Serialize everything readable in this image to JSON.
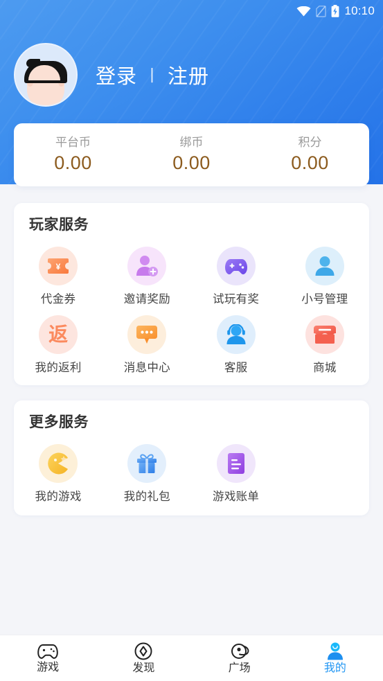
{
  "status_bar": {
    "time": "10:10",
    "icons": [
      "wifi-icon",
      "sim-off-icon",
      "battery-charging-icon"
    ]
  },
  "header": {
    "avatar_name": "default-user-avatar",
    "login_label": "登录",
    "separator": "丨",
    "register_label": "注册",
    "background_color": "#3E8FEE"
  },
  "balance": {
    "items": [
      {
        "label": "平台币",
        "value": "0.00"
      },
      {
        "label": "绑币",
        "value": "0.00"
      },
      {
        "label": "积分",
        "value": "0.00"
      }
    ],
    "value_color": "#8C5B1E",
    "label_color": "#9A9A9A"
  },
  "player_services": {
    "title": "玩家服务",
    "items": [
      {
        "label": "代金券",
        "icon": "voucher-icon",
        "bg": "#FDE7DE",
        "fg": "#FB8A4E"
      },
      {
        "label": "邀请奖励",
        "icon": "invite-user-icon",
        "bg": "#F7E4FB",
        "fg": "#D08BF0"
      },
      {
        "label": "试玩有奖",
        "icon": "gamepad-icon",
        "bg": "#EAE4FB",
        "fg": "#7A5CF0"
      },
      {
        "label": "小号管理",
        "icon": "person-icon",
        "bg": "#DDEFFB",
        "fg": "#4EB3EC"
      },
      {
        "label": "我的返利",
        "icon": "rebate-icon",
        "bg": "#FDE5DF",
        "fg": "#FB8A5E"
      },
      {
        "label": "消息中心",
        "icon": "message-icon",
        "bg": "#FDEEDC",
        "fg": "#FBA13E"
      },
      {
        "label": "客服",
        "icon": "headset-icon",
        "bg": "#DFEEFC",
        "fg": "#2196F3"
      },
      {
        "label": "商城",
        "icon": "shop-icon",
        "bg": "#FDE2DF",
        "fg": "#F4604F"
      }
    ]
  },
  "more_services": {
    "title": "更多服务",
    "items": [
      {
        "label": "我的游戏",
        "icon": "pacman-icon",
        "bg": "#FDF0D8",
        "fg": "#F9C22E"
      },
      {
        "label": "我的礼包",
        "icon": "gift-icon",
        "bg": "#E3EFFC",
        "fg": "#4A90EC"
      },
      {
        "label": "游戏账单",
        "icon": "document-icon",
        "bg": "#F0E6FB",
        "fg": "#A35CE8"
      }
    ]
  },
  "bottom_nav": {
    "active_color": "#2196F3",
    "items": [
      {
        "label": "游戏",
        "icon": "gamepad-outline-icon",
        "active": false
      },
      {
        "label": "发现",
        "icon": "compass-outline-icon",
        "active": false
      },
      {
        "label": "广场",
        "icon": "planet-outline-icon",
        "active": false
      },
      {
        "label": "我的",
        "icon": "person-filled-icon",
        "active": true
      }
    ]
  }
}
